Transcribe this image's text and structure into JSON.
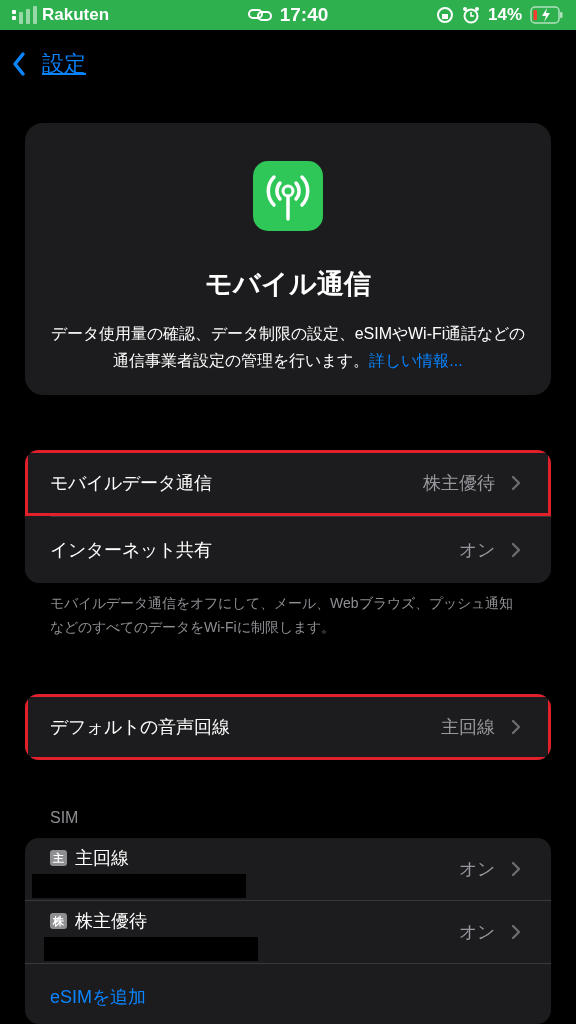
{
  "status_bar": {
    "carrier": "Rakuten",
    "time": "17:40",
    "battery": "14%"
  },
  "nav": {
    "back_label": "設定"
  },
  "header_card": {
    "title": "モバイル通信",
    "description": "データ使用量の確認、データ制限の設定、eSIMやWi-Fi通話などの通信事業者設定の管理を行います。",
    "link": "詳しい情報..."
  },
  "groups": [
    {
      "rows": [
        {
          "label": "モバイルデータ通信",
          "value": "株主優待",
          "highlighted": true
        },
        {
          "label": "インターネット共有",
          "value": "オン",
          "highlighted": false
        }
      ],
      "footer": "モバイルデータ通信をオフにして、メール、Webブラウズ、プッシュ通知などのすべてのデータをWi-Fiに制限します。"
    },
    {
      "rows": [
        {
          "label": "デフォルトの音声回線",
          "value": "主回線",
          "highlighted": true
        }
      ]
    }
  ],
  "sim": {
    "header": "SIM",
    "lines": [
      {
        "badge": "主",
        "label": "主回線",
        "value": "オン",
        "redacted": true
      },
      {
        "badge": "株",
        "label": "株主優待",
        "value": "オン",
        "redacted": true
      }
    ],
    "add_label": "eSIMを追加"
  }
}
